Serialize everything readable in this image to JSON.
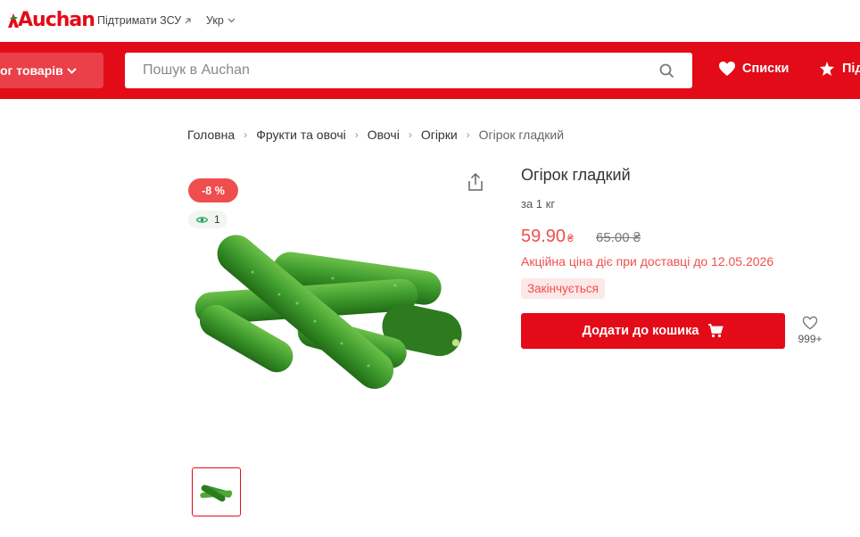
{
  "header": {
    "logo_text": "Auchan",
    "support_link": "Підтримати ЗСУ",
    "language": "Укр"
  },
  "navbar": {
    "catalog_label": "ог товарів",
    "search_placeholder": "Пошук в Auchan",
    "lists_label": "Списки",
    "more_label": "Під"
  },
  "breadcrumb": [
    "Головна",
    "Фрукти та овочі",
    "Овочі",
    "Огірки",
    "Огірок гладкий"
  ],
  "product": {
    "discount": "-8 %",
    "views": "1",
    "title": "Огірок гладкий",
    "unit": "за 1 кг",
    "price": "59.90",
    "currency": "₴",
    "old_price": "65.00 ₴",
    "promo_note": "Акційна ціна діє при доставці до 12.05.2026",
    "stock_badge": "Закінчується",
    "add_to_cart": "Додати до кошика",
    "favorites_count": "999+"
  },
  "colors": {
    "brand_red": "#e30b17",
    "sale_red": "#f04e4e",
    "badge_bg": "#fde8e8"
  },
  "icons": [
    "bird-logo-icon",
    "external-link-icon",
    "chevron-down-icon",
    "search-icon",
    "heart-icon",
    "star-icon",
    "eye-icon",
    "share-icon",
    "cart-icon",
    "heart-outline-icon"
  ]
}
